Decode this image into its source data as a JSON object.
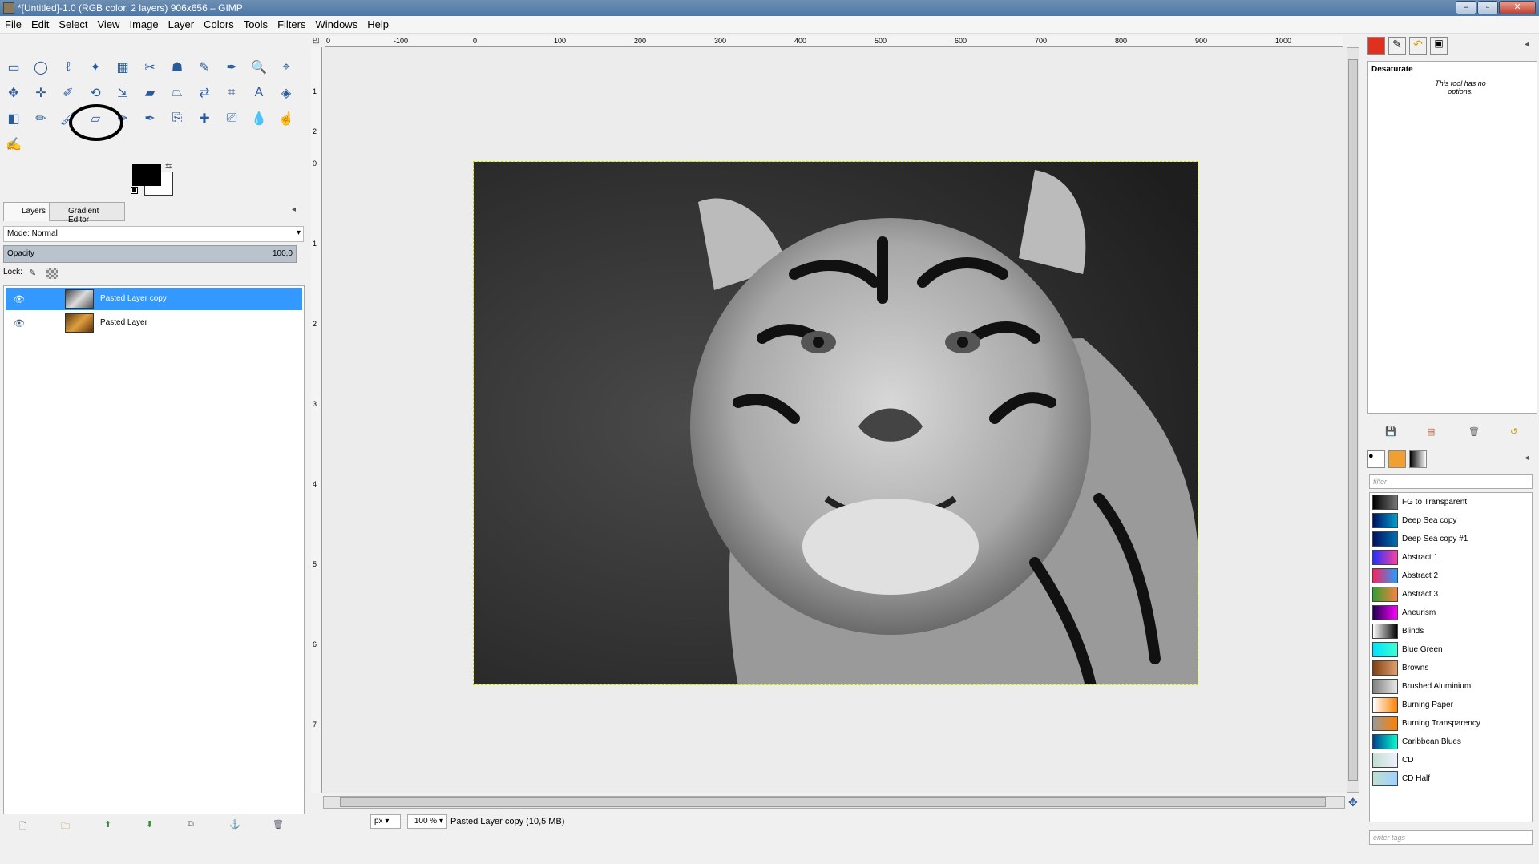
{
  "window": {
    "title": "*[Untitled]-1.0 (RGB color, 2 layers) 906x656 – GIMP"
  },
  "menu": [
    "File",
    "Edit",
    "Select",
    "View",
    "Image",
    "Layer",
    "Colors",
    "Tools",
    "Filters",
    "Windows",
    "Help"
  ],
  "toolbox": {
    "tools": [
      {
        "name": "rect-select-icon",
        "glyph": "▭"
      },
      {
        "name": "ellipse-select-icon",
        "glyph": "◯"
      },
      {
        "name": "free-select-icon",
        "glyph": "ℓ"
      },
      {
        "name": "fuzzy-select-icon",
        "glyph": "✦"
      },
      {
        "name": "color-select-icon",
        "glyph": "▦"
      },
      {
        "name": "scissors-icon",
        "glyph": "✂"
      },
      {
        "name": "foreground-select-icon",
        "glyph": "☗"
      },
      {
        "name": "paths-icon",
        "glyph": "✎"
      },
      {
        "name": "color-picker-icon",
        "glyph": "✒"
      },
      {
        "name": "zoom-icon",
        "glyph": "🔍"
      },
      {
        "name": "measure-icon",
        "glyph": "⌖"
      },
      {
        "name": "move-icon",
        "glyph": "✥"
      },
      {
        "name": "align-icon",
        "glyph": "✛"
      },
      {
        "name": "crop-icon",
        "glyph": "✐"
      },
      {
        "name": "rotate-icon",
        "glyph": "⟲"
      },
      {
        "name": "scale-icon",
        "glyph": "⇲"
      },
      {
        "name": "shear-icon",
        "glyph": "▰"
      },
      {
        "name": "perspective-icon",
        "glyph": "⏢"
      },
      {
        "name": "flip-icon",
        "glyph": "⇄"
      },
      {
        "name": "cage-icon",
        "glyph": "⌗"
      },
      {
        "name": "text-icon",
        "glyph": "A"
      },
      {
        "name": "bucket-fill-icon",
        "glyph": "◈"
      },
      {
        "name": "blend-icon",
        "glyph": "◧"
      },
      {
        "name": "pencil-icon",
        "glyph": "✏"
      },
      {
        "name": "paintbrush-icon",
        "glyph": "🖌"
      },
      {
        "name": "eraser-icon",
        "glyph": "▱"
      },
      {
        "name": "airbrush-icon",
        "glyph": "✑"
      },
      {
        "name": "ink-icon",
        "glyph": "✒"
      },
      {
        "name": "clone-icon",
        "glyph": "⎘"
      },
      {
        "name": "heal-icon",
        "glyph": "✚"
      },
      {
        "name": "perspective-clone-icon",
        "glyph": "⎚"
      },
      {
        "name": "blur-icon",
        "glyph": "💧"
      },
      {
        "name": "smudge-icon",
        "glyph": "☝"
      },
      {
        "name": "dodge-burn-icon",
        "glyph": "✍"
      }
    ],
    "fg_color": "#000000",
    "bg_color": "#ffffff"
  },
  "layers_dock": {
    "tabs": [
      "Layers",
      "Gradient Editor"
    ],
    "mode_label": "Mode: Normal",
    "opacity_label": "Opacity",
    "opacity_value": "100,0",
    "lock_label": "Lock:",
    "layers": [
      {
        "name": "Pasted Layer copy",
        "selected": true
      },
      {
        "name": "Pasted Layer",
        "selected": false
      }
    ]
  },
  "rulers": {
    "top": [
      "0",
      "-100",
      "0",
      "100",
      "200",
      "300",
      "400",
      "500",
      "600",
      "700",
      "800",
      "900",
      "1000"
    ],
    "left": [
      "1",
      "2",
      "0",
      "1",
      "2",
      "3",
      "4",
      "5",
      "6",
      "7"
    ]
  },
  "status": {
    "unit": "px",
    "zoom": "100 %",
    "message": "Pasted Layer copy (10,5 MB)"
  },
  "tool_options": {
    "title": "Desaturate",
    "note": "This tool has no options."
  },
  "gradients": {
    "filter_placeholder": "filter",
    "tags_placeholder": "enter tags",
    "items": [
      {
        "name": "FG to Transparent",
        "c1": "#000000",
        "c2": "#777777"
      },
      {
        "name": "Deep Sea copy",
        "c1": "#001060",
        "c2": "#00a0d0"
      },
      {
        "name": "Deep Sea copy #1",
        "c1": "#001060",
        "c2": "#0070b0"
      },
      {
        "name": "Abstract 1",
        "c1": "#2030ff",
        "c2": "#ff40a0"
      },
      {
        "name": "Abstract 2",
        "c1": "#ff2060",
        "c2": "#20a0ff"
      },
      {
        "name": "Abstract 3",
        "c1": "#30a030",
        "c2": "#ff8040"
      },
      {
        "name": "Aneurism",
        "c1": "#200050",
        "c2": "#ff00ff"
      },
      {
        "name": "Blinds",
        "c1": "#ffffff",
        "c2": "#000000"
      },
      {
        "name": "Blue Green",
        "c1": "#00e0ff",
        "c2": "#40ffd0"
      },
      {
        "name": "Browns",
        "c1": "#804010",
        "c2": "#e0a070"
      },
      {
        "name": "Brushed Aluminium",
        "c1": "#808080",
        "c2": "#e8e8e8"
      },
      {
        "name": "Burning Paper",
        "c1": "#ffffff",
        "c2": "#ff8000"
      },
      {
        "name": "Burning Transparency",
        "c1": "#999999",
        "c2": "#ff8000"
      },
      {
        "name": "Caribbean Blues",
        "c1": "#004090",
        "c2": "#00ffcc"
      },
      {
        "name": "CD",
        "c1": "#c0e0d0",
        "c2": "#f0f0ff"
      },
      {
        "name": "CD Half",
        "c1": "#c0e0d0",
        "c2": "#a0d0ff"
      }
    ]
  }
}
